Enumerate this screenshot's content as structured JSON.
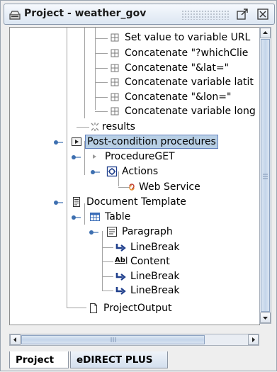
{
  "window": {
    "title": "Project - weather_gov"
  },
  "tree": {
    "nodes": [
      {
        "label": "Set value to variable URL"
      },
      {
        "label": "Concatenate \"?whichClie"
      },
      {
        "label": "Concatenate \"&lat=\""
      },
      {
        "label": "Concatenate variable latit"
      },
      {
        "label": "Concatenate \"&lon=\""
      },
      {
        "label": "Concatenate variable long"
      },
      {
        "label": "results"
      },
      {
        "label": "Post-condition procedures"
      },
      {
        "label": "ProcedureGET"
      },
      {
        "label": "Actions"
      },
      {
        "label": "Web Service"
      },
      {
        "label": "Document Template"
      },
      {
        "label": "Table"
      },
      {
        "label": "Paragraph"
      },
      {
        "label": "LineBreak"
      },
      {
        "label": "Content"
      },
      {
        "label": "LineBreak"
      },
      {
        "label": "LineBreak"
      },
      {
        "label": "ProjectOutput"
      }
    ]
  },
  "tabs": [
    {
      "label": "Project",
      "active": true
    },
    {
      "label": "eDIRECT PLUS",
      "active": false
    }
  ],
  "icons": {
    "content_icon_text": "Ab|"
  },
  "colors": {
    "selection": "#b8cfe5",
    "selection_border": "#6382bf",
    "scroll_thumb": "#c8d7ea"
  }
}
